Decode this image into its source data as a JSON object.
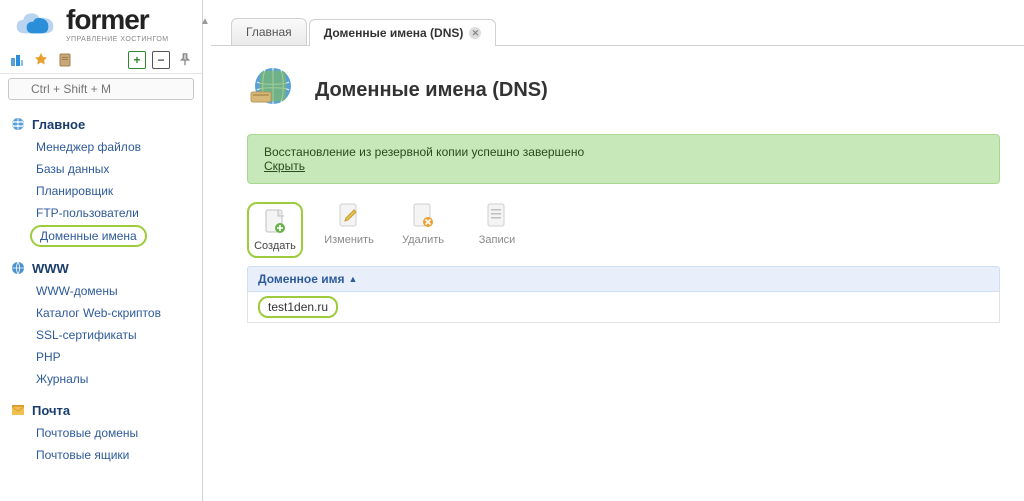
{
  "brand": {
    "name": "former",
    "tagline": "управление хостингом"
  },
  "search": {
    "placeholder": "Ctrl + Shift + M"
  },
  "nav": {
    "groups": [
      {
        "title": "Главное",
        "items": [
          "Менеджер файлов",
          "Базы данных",
          "Планировщик",
          "FTP-пользователи",
          "Доменные имена"
        ],
        "activeIndex": 4
      },
      {
        "title": "WWW",
        "items": [
          "WWW-домены",
          "Каталог Web-скриптов",
          "SSL-сертификаты",
          "PHP",
          "Журналы"
        ]
      },
      {
        "title": "Почта",
        "items": [
          "Почтовые домены",
          "Почтовые ящики"
        ]
      }
    ]
  },
  "tabs": {
    "home": "Главная",
    "active": "Доменные имена (DNS)"
  },
  "page": {
    "title": "Доменные имена (DNS)"
  },
  "notice": {
    "text": "Восстановление из резервной копии успешно завершено",
    "hide": "Скрыть"
  },
  "actions": {
    "create": "Создать",
    "edit": "Изменить",
    "delete": "Удалить",
    "records": "Записи"
  },
  "table": {
    "header": "Доменное имя",
    "rows": [
      "test1den.ru"
    ]
  }
}
